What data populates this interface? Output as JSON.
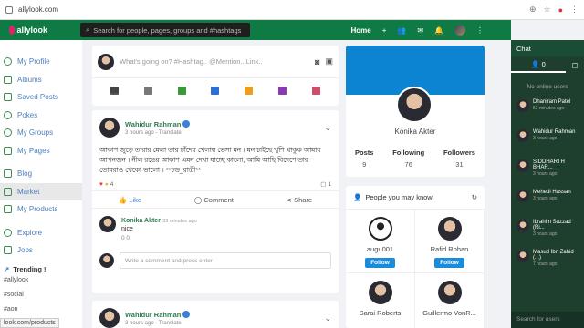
{
  "browser": {
    "url": "allylook.com"
  },
  "nav": {
    "logo": "allylook",
    "search_placeholder": "Search for people, pages, groups and #hashtags",
    "home": "Home"
  },
  "sidebar": {
    "items": [
      {
        "label": "My Profile"
      },
      {
        "label": "Albums"
      },
      {
        "label": "Saved Posts"
      },
      {
        "label": "Pokes"
      },
      {
        "label": "My Groups"
      },
      {
        "label": "My Pages"
      },
      {
        "label": "Blog"
      },
      {
        "label": "Market"
      },
      {
        "label": "My Products"
      },
      {
        "label": "Explore"
      },
      {
        "label": "Jobs"
      }
    ],
    "trending_title": "Trending !",
    "tags": [
      "#allylook",
      "#social",
      "#aon"
    ],
    "status_url": "look.com/products"
  },
  "composer": {
    "placeholder": "What's going on? #Hashtag.. @Mention.. Link.."
  },
  "posts": [
    {
      "author": "Wahidur Rahman",
      "meta": "3 hours ago - Translate",
      "text": "আকাশ জুড়ে তারার মেলা তার চাঁদের খেলায় ভেসা মন । মন চাইছে খুশি থাকুক আমার আপনজন । নীল রঙের আকাশ এমন দেখা যাচ্ছে কালো, আমি আছি বিদেশে তার তোমরাও থেকো ভালো । **চড_রাত্রী**",
      "reactions": "4",
      "comments": "1",
      "like": "Like",
      "comment": "Comment",
      "share": "Share",
      "reply": {
        "author": "Konika Akter",
        "time": "33 minutes ago",
        "text": "nice",
        "reacts": "0   0"
      },
      "write_placeholder": "Write a comment and press enter"
    },
    {
      "author": "Wahidur Rahman",
      "meta": "3 hours ago - Translate"
    }
  ],
  "profile": {
    "name": "Konika Akter",
    "stats": [
      {
        "label": "Posts",
        "value": "9"
      },
      {
        "label": "Following",
        "value": "76"
      },
      {
        "label": "Followers",
        "value": "31"
      }
    ]
  },
  "people": {
    "title": "People you may know",
    "follow": "Follow",
    "list": [
      {
        "name": "augu001"
      },
      {
        "name": "Rafid Rohan"
      },
      {
        "name": "Sarai Roberts"
      },
      {
        "name": "Guillermo VonR..."
      }
    ]
  },
  "chat": {
    "title": "Chat",
    "online_count": "0",
    "no_online": "No online users",
    "users": [
      {
        "name": "Dhaniram Patel",
        "time": "52 minutes ago"
      },
      {
        "name": "Wahidur Rahman",
        "time": "3 hours ago"
      },
      {
        "name": "SIDDHARTH BHAR...",
        "time": "3 hours ago"
      },
      {
        "name": "Mehedi Hassan",
        "time": "3 hours ago"
      },
      {
        "name": "Ibrahim Sazzad (Ri...",
        "time": "3 hours ago"
      },
      {
        "name": "Masud Ibn Zahid (...)",
        "time": "7 hours ago"
      }
    ],
    "search_placeholder": "Search for users"
  },
  "colors": {
    "brand": "#0f7a44",
    "accent": "#1a8cdb",
    "link": "#4a7fbf"
  }
}
